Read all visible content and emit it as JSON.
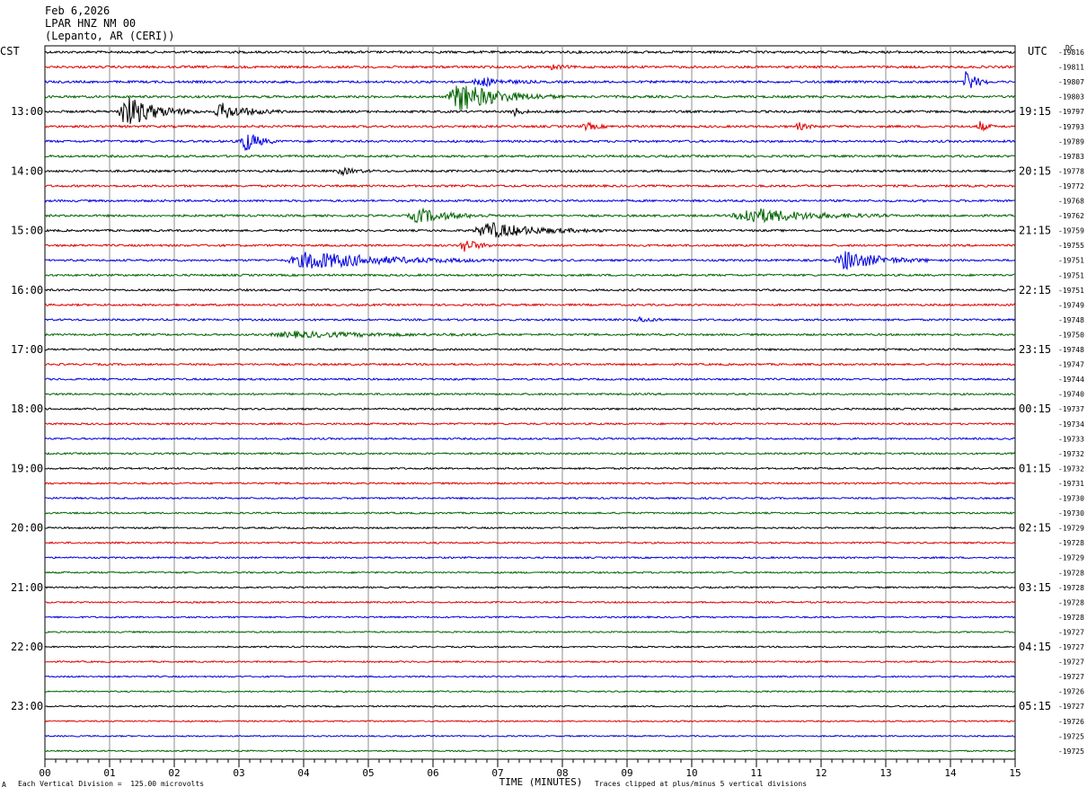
{
  "header": {
    "date": "Feb 6,2026",
    "station": "LPAR HNZ NM 00",
    "location": "(Lepanto, AR (CERI))"
  },
  "left_axis_title": "CST",
  "right_axis_title": "UTC",
  "dc_label": "DC",
  "footer": {
    "scale_note": "Each Vertical Division =  125.00 microvolts",
    "clip_note": "Traces clipped at plus/minus 5 vertical divisions",
    "corner_mark": "A"
  },
  "chart_data": {
    "type": "line",
    "xlabel": "TIME (MINUTES)",
    "xlim": [
      0,
      15
    ],
    "x_ticks": [
      "00",
      "01",
      "02",
      "03",
      "04",
      "05",
      "06",
      "07",
      "08",
      "09",
      "10",
      "11",
      "12",
      "13",
      "14",
      "15"
    ],
    "trace_colors": [
      "#000000",
      "#e00000",
      "#0000e0",
      "#006400"
    ],
    "left_labels": [
      "13:00",
      "14:00",
      "15:00",
      "16:00",
      "17:00",
      "18:00",
      "19:00",
      "20:00",
      "21:00",
      "22:00",
      "23:00"
    ],
    "right_labels": [
      "19:15",
      "20:15",
      "21:15",
      "22:15",
      "23:15",
      "00:15",
      "01:15",
      "02:15",
      "03:15",
      "04:15",
      "05:15"
    ],
    "dc_offsets": [
      "-19816",
      "-19811",
      "-19807",
      "-19803",
      "-19797",
      "-19793",
      "-19789",
      "-19783",
      "-19778",
      "-19772",
      "-19768",
      "-19762",
      "-19759",
      "-19755",
      "-19751",
      "-19751",
      "-19751",
      "-19749",
      "-19748",
      "-19750",
      "-19748",
      "-19747",
      "-19744",
      "-19740",
      "-19737",
      "-19734",
      "-19733",
      "-19732",
      "-19732",
      "-19731",
      "-19730",
      "-19730",
      "-19729",
      "-19728",
      "-19729",
      "-19728",
      "-19728",
      "-19728",
      "-19728",
      "-19727",
      "-19727",
      "-19727",
      "-19727",
      "-19726",
      "-19727",
      "-19726",
      "-19725",
      "-19725"
    ],
    "events": [
      {
        "trace": 1,
        "minute": 7.8,
        "duration": 0.4,
        "amp": 3
      },
      {
        "trace": 2,
        "minute": 6.6,
        "duration": 1.0,
        "amp": 5
      },
      {
        "trace": 2,
        "minute": 14.2,
        "duration": 0.4,
        "amp": 14
      },
      {
        "trace": 3,
        "minute": 6.2,
        "duration": 1.8,
        "amp": 16
      },
      {
        "trace": 4,
        "minute": 1.1,
        "duration": 1.3,
        "amp": 18
      },
      {
        "trace": 4,
        "minute": 2.6,
        "duration": 1.1,
        "amp": 9
      },
      {
        "trace": 4,
        "minute": 7.2,
        "duration": 0.3,
        "amp": 6
      },
      {
        "trace": 5,
        "minute": 8.3,
        "duration": 0.5,
        "amp": 4
      },
      {
        "trace": 5,
        "minute": 11.6,
        "duration": 0.4,
        "amp": 4
      },
      {
        "trace": 5,
        "minute": 14.4,
        "duration": 0.3,
        "amp": 7
      },
      {
        "trace": 6,
        "minute": 3.0,
        "duration": 0.6,
        "amp": 14
      },
      {
        "trace": 8,
        "minute": 4.5,
        "duration": 0.6,
        "amp": 4
      },
      {
        "trace": 11,
        "minute": 5.6,
        "duration": 1.4,
        "amp": 8
      },
      {
        "trace": 11,
        "minute": 10.6,
        "duration": 2.5,
        "amp": 9
      },
      {
        "trace": 12,
        "minute": 6.6,
        "duration": 2.1,
        "amp": 9
      },
      {
        "trace": 13,
        "minute": 6.4,
        "duration": 0.6,
        "amp": 8
      },
      {
        "trace": 14,
        "minute": 3.7,
        "duration": 3.3,
        "amp": 10
      },
      {
        "trace": 14,
        "minute": 12.2,
        "duration": 1.5,
        "amp": 11
      },
      {
        "trace": 19,
        "minute": 3.4,
        "duration": 3.8,
        "amp": 3
      },
      {
        "trace": 18,
        "minute": 9.1,
        "duration": 0.6,
        "amp": 3
      }
    ]
  }
}
